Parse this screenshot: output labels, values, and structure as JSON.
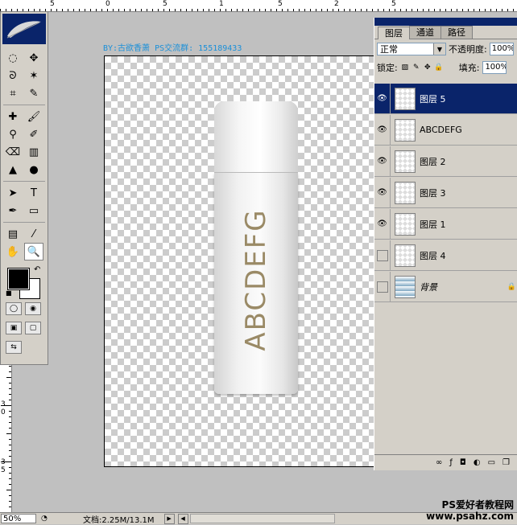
{
  "canvas": {
    "credit_text": "BY:古欲香萧 PS交流群: 155189433",
    "bottle_label": "ABCDEFG"
  },
  "rulers": {
    "top_labels": [
      "5",
      "0",
      "5",
      "1",
      "5",
      "2",
      "5"
    ],
    "left_labels": [
      "3",
      "0",
      "3",
      "5"
    ]
  },
  "layers_panel": {
    "tabs": [
      {
        "label": "图层",
        "active": true
      },
      {
        "label": "通道",
        "active": false
      },
      {
        "label": "路径",
        "active": false
      }
    ],
    "blend_mode": "正常",
    "opacity_label": "不透明度:",
    "opacity_value": "100%",
    "lock_label": "锁定:",
    "fill_label": "填充:",
    "fill_value": "100%",
    "layers": [
      {
        "name": "图层 5",
        "visible": true,
        "selected": true,
        "thumb": "checker"
      },
      {
        "name": "ABCDEFG",
        "visible": true,
        "selected": false,
        "thumb": "checker"
      },
      {
        "name": "图层 2",
        "visible": true,
        "selected": false,
        "thumb": "checker"
      },
      {
        "name": "图层 3",
        "visible": true,
        "selected": false,
        "thumb": "checker"
      },
      {
        "name": "图层 1",
        "visible": true,
        "selected": false,
        "thumb": "checker"
      },
      {
        "name": "图层 4",
        "visible": false,
        "selected": false,
        "thumb": "checker"
      },
      {
        "name": "背景",
        "visible": false,
        "selected": false,
        "thumb": "gradient",
        "italic": true,
        "locked": true
      }
    ]
  },
  "statusbar": {
    "zoom": "50%",
    "doc_info": "文档:2.25M/13.1M"
  },
  "watermark": {
    "line1": "PS爱好者教程网",
    "line2": "www.psahz.com"
  },
  "colors": {
    "selection": "#0a246a",
    "panel_bg": "#d4d0c8",
    "label_gold": "#9a8a66",
    "credit_blue": "#1a8fd8"
  }
}
